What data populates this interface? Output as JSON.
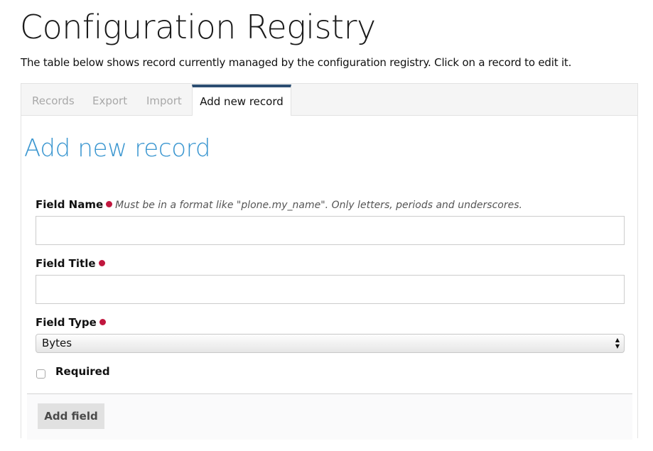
{
  "page": {
    "title": "Configuration Registry",
    "description": "The table below shows record currently managed by the configuration registry. Click on a record to edit it."
  },
  "tabs": [
    {
      "label": "Records",
      "active": false
    },
    {
      "label": "Export",
      "active": false
    },
    {
      "label": "Import",
      "active": false
    },
    {
      "label": "Add new record",
      "active": true
    }
  ],
  "form": {
    "title": "Add new record",
    "fields": {
      "field_name": {
        "label": "Field Name",
        "required": true,
        "help": "Must be in a format like \"plone.my_name\". Only letters, periods and underscores.",
        "value": ""
      },
      "field_title": {
        "label": "Field Title",
        "required": true,
        "value": ""
      },
      "field_type": {
        "label": "Field Type",
        "required": true,
        "selected": "Bytes"
      },
      "required_checkbox": {
        "label": "Required",
        "checked": false
      }
    },
    "submit_label": "Add field"
  },
  "colors": {
    "accent_title": "#3a96d0",
    "active_tab_border": "#2c4e72",
    "required_dot": "#c0173e"
  }
}
